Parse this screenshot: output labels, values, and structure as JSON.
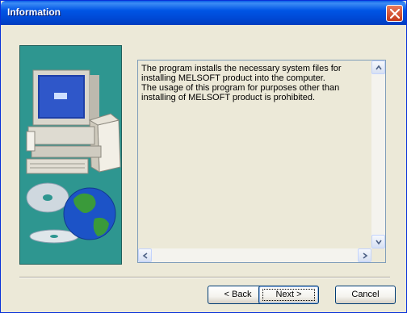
{
  "window": {
    "title": "Information"
  },
  "message": {
    "text": "The program installs the necessary system files for\ninstalling MELSOFT product into the computer.\nThe usage of this program for purposes other than\ninstalling of MELSOFT product is prohibited."
  },
  "buttons": {
    "back_prefix": "< ",
    "back_label": "Back",
    "next_label": "Next",
    "next_suffix": " >",
    "cancel_label": "Cancel"
  },
  "icons": {
    "close": "close-icon",
    "scroll_up": "arrow-up-icon",
    "scroll_down": "arrow-down-icon",
    "scroll_left": "arrow-left-icon",
    "scroll_right": "arrow-right-icon",
    "illustration": "computer-and-cd-globe-illustration"
  },
  "colors": {
    "title_bar": "#0055e5",
    "panel_bg": "#2e9690",
    "close_button": "#c4391b"
  }
}
